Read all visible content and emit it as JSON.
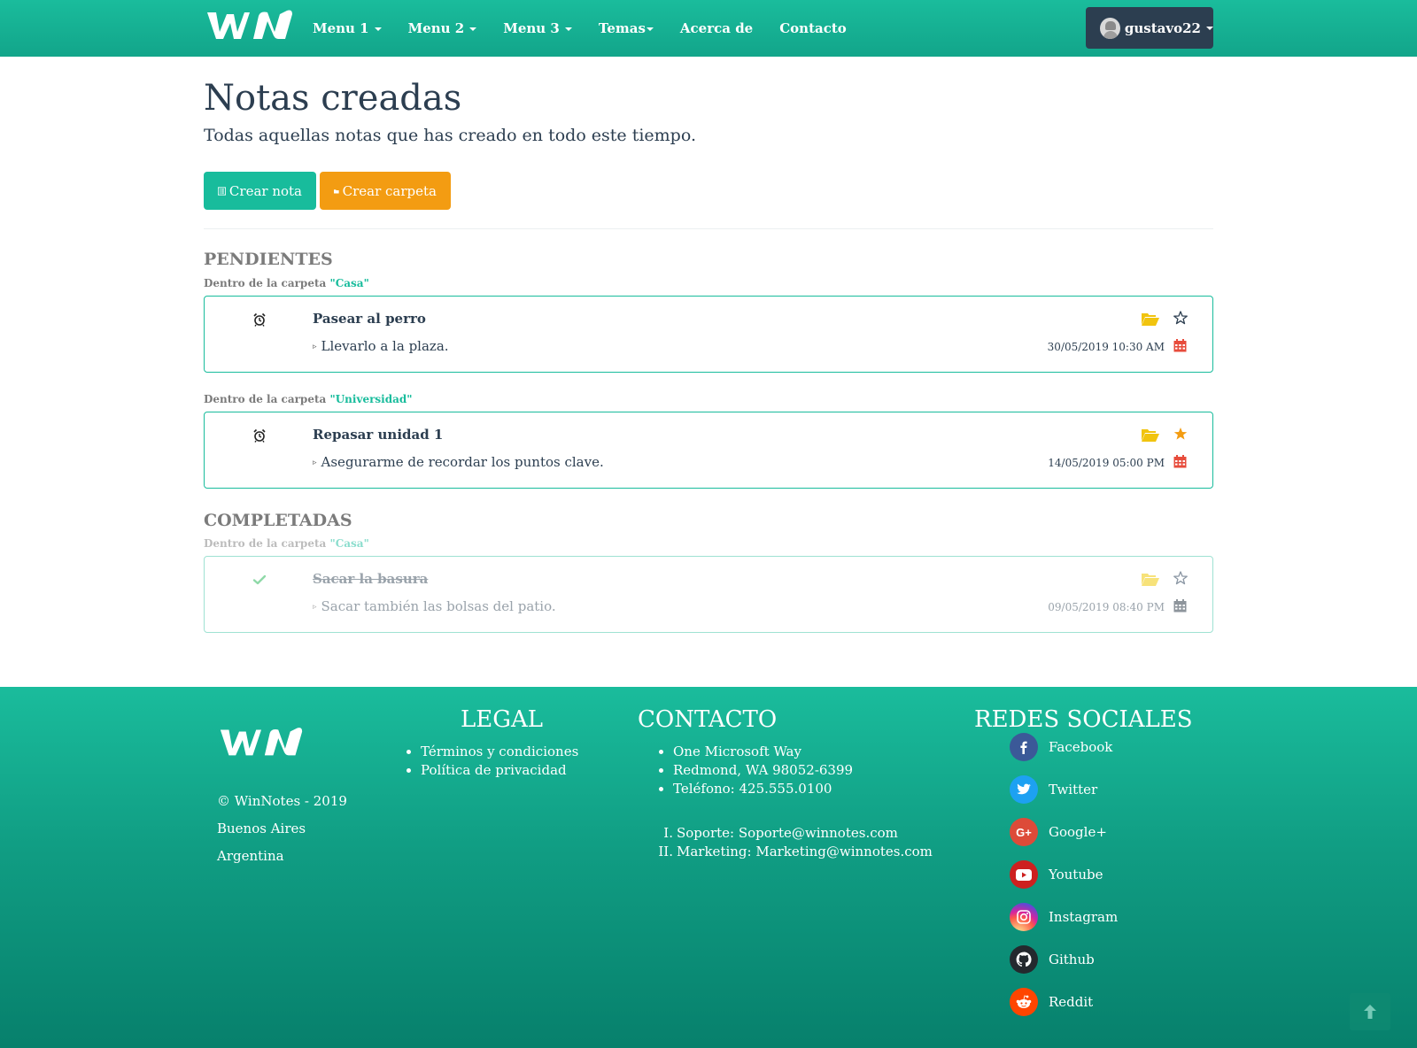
{
  "navbar": {
    "brand": "WN",
    "menu": [
      {
        "label": "Menu 1",
        "dropdown": true
      },
      {
        "label": "Menu 2",
        "dropdown": true
      },
      {
        "label": "Menu 3",
        "dropdown": true
      },
      {
        "label": "Temas",
        "dropdown": true
      },
      {
        "label": "Acerca de",
        "dropdown": false
      },
      {
        "label": "Contacto",
        "dropdown": false
      }
    ],
    "user": "gustavo22"
  },
  "main": {
    "title": "Notas creadas",
    "subtitle": "Todas aquellas notas que has creado en todo este tiempo.",
    "create_note_label": "Crear nota",
    "create_folder_label": "Crear carpeta"
  },
  "sections": {
    "pending": {
      "title": "PENDIENTES",
      "notes": [
        {
          "folder_prefix": "Dentro de la carpeta",
          "folder": "\"Casa\"",
          "title": "Pasear al perro",
          "description": "Llevarlo a la plaza.",
          "date": "30/05/2019 10:30 AM",
          "starred": false
        },
        {
          "folder_prefix": "Dentro de la carpeta",
          "folder": "\"Universidad\"",
          "title": "Repasar unidad 1",
          "description": "Asegurarme de recordar los puntos clave.",
          "date": "14/05/2019 05:00 PM",
          "starred": true
        }
      ]
    },
    "completed": {
      "title": "COMPLETADAS",
      "notes": [
        {
          "folder_prefix": "Dentro de la carpeta",
          "folder": "\"Casa\"",
          "title": "Sacar la basura",
          "description": "Sacar también las bolsas del patio.",
          "date": "09/05/2019 08:40 PM",
          "starred": false
        }
      ]
    }
  },
  "footer": {
    "brand": "WN",
    "copyright": "© WinNotes - 2019",
    "city": "Buenos Aires",
    "country": "Argentina",
    "legal": {
      "heading": "LEGAL",
      "items": [
        "Términos y condiciones",
        "Política de privacidad"
      ]
    },
    "contact": {
      "heading": "CONTACTO",
      "items": [
        "One Microsoft Way",
        "Redmond, WA 98052-6399",
        "Teléfono: 425.555.0100"
      ],
      "emails": [
        {
          "num": "I.",
          "text": "Soporte: Soporte@winnotes.com"
        },
        {
          "num": "II.",
          "text": "Marketing: Marketing@winnotes.com"
        }
      ]
    },
    "social": {
      "heading": "REDES SOCIALES",
      "items": [
        {
          "label": "Facebook",
          "icon": "facebook-icon",
          "color": "#3b5998"
        },
        {
          "label": "Twitter",
          "icon": "twitter-icon",
          "color": "#1da1f2"
        },
        {
          "label": "Google+",
          "icon": "google-plus-icon",
          "color": "#dd4b39"
        },
        {
          "label": "Youtube",
          "icon": "youtube-icon",
          "color": "#cd201f"
        },
        {
          "label": "Instagram",
          "icon": "instagram-icon",
          "color": "#c13584"
        },
        {
          "label": "Github",
          "icon": "github-icon",
          "color": "#333333"
        },
        {
          "label": "Reddit",
          "icon": "reddit-icon",
          "color": "#ff4500"
        }
      ]
    }
  },
  "colors": {
    "primary": "#18bc9c",
    "warning": "#f39c12",
    "dark": "#2c3e50",
    "danger": "#e74c3c"
  }
}
